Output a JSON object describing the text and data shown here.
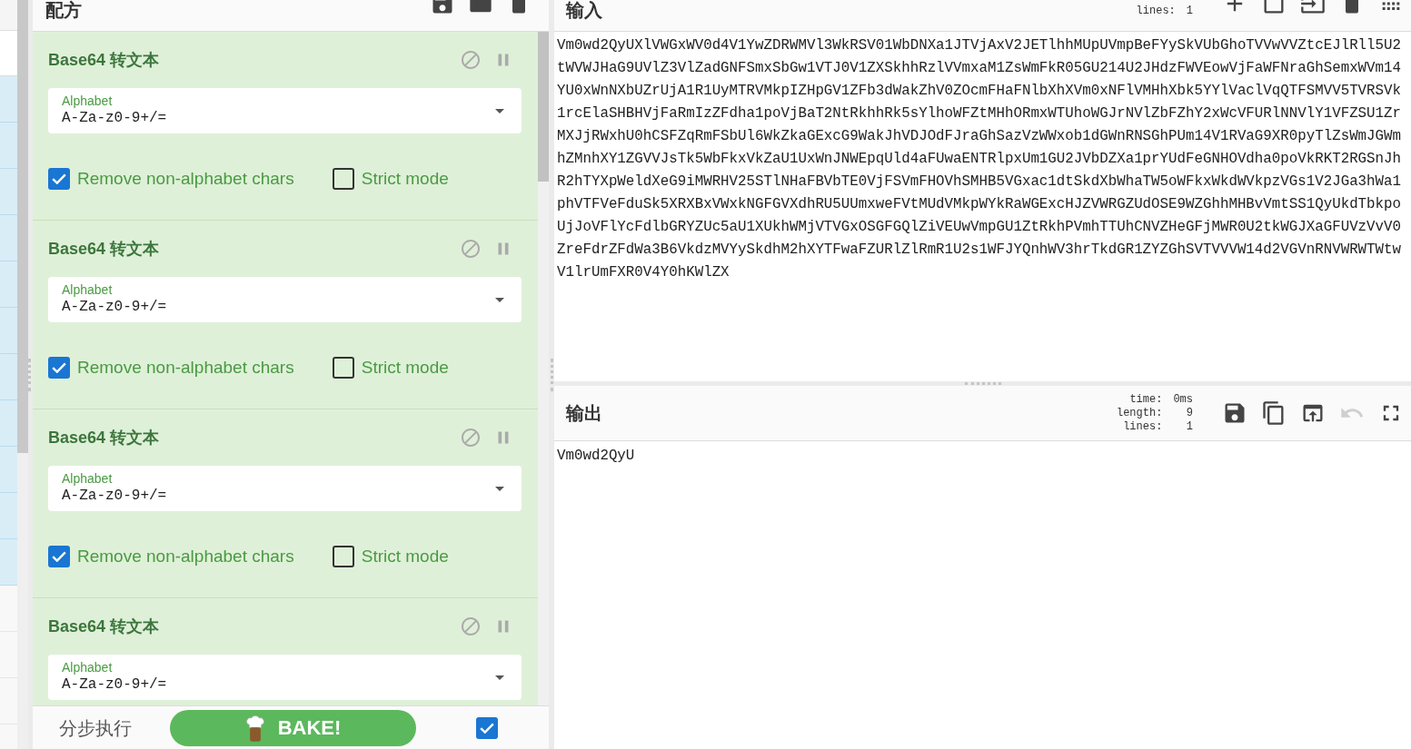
{
  "recipe": {
    "title": "配方",
    "operations": [
      {
        "title": "Base64 转文本",
        "args": [
          {
            "kind": "dropdown",
            "label": "Alphabet",
            "value": "A-Za-z0-9+/="
          },
          {
            "kind": "checkbox",
            "label": "Remove non-alphabet chars",
            "checked": true
          },
          {
            "kind": "checkbox",
            "label": "Strict mode",
            "checked": false
          }
        ]
      },
      {
        "title": "Base64 转文本",
        "args": [
          {
            "kind": "dropdown",
            "label": "Alphabet",
            "value": "A-Za-z0-9+/="
          },
          {
            "kind": "checkbox",
            "label": "Remove non-alphabet chars",
            "checked": true
          },
          {
            "kind": "checkbox",
            "label": "Strict mode",
            "checked": false
          }
        ]
      },
      {
        "title": "Base64 转文本",
        "args": [
          {
            "kind": "dropdown",
            "label": "Alphabet",
            "value": "A-Za-z0-9+/="
          },
          {
            "kind": "checkbox",
            "label": "Remove non-alphabet chars",
            "checked": true
          },
          {
            "kind": "checkbox",
            "label": "Strict mode",
            "checked": false
          }
        ]
      },
      {
        "title": "Base64 转文本",
        "args": [
          {
            "kind": "dropdown",
            "label": "Alphabet",
            "value": "A-Za-z0-9+/="
          }
        ]
      }
    ]
  },
  "controls": {
    "step": "分步执行",
    "bake": "BAKE!",
    "auto_bake": {
      "checked": true
    }
  },
  "input": {
    "title": "输入",
    "stats": [
      {
        "label": "lines:",
        "value": "1"
      }
    ],
    "lines": [
      "Vm0wd2QyUXlVWGxWV0d4V1YwZDRWMVl3WkRSV01WbDNXa1JTVjAxV2JETlhhMUpUVmpBeFYySkVUbGhoTVVwVVZtcEJlRll5U2",
      "tWVWJHaG9UVlZ3VlZadGNFSmxSbGw1VTJ0V1ZXSkhhRzlVVmxaM1ZsWmFkR05GU214U2JHdzFWVEowVjFaWFNraGhSemxWVm14",
      "YU0xWnNXbUZrUjA1R1UyMTRVMkpIZHpGV1ZFb3dWakZhV0ZOcmFHaFNlbXhXVm0xNFlVMHhXbk5YYlVaclVqQTFSMVV5TVRSVk",
      "1rcElaSHBHVjFaRmIzZFdha1poVjBaT2NtRkhhRk5sYlhoWFZtMHhORmxWTUhoWGJrNVlZbFZhY2xWcVFURlNNVlY1VFZSU1Zr",
      "MXJjRWxhU0hCSFZqRmFSbUl6WkZkaGExcG9WakJhVDJOdFJraGhSazVzWWxob1dGWnRNSGhPUm14V1RVaG9XR0pyTlZsWmJGWm",
      "hZMnhXY1ZGVVJsTk5WbFkxVkZaU1UxWnJNWEpqUld4aFUwaENTRlpxUm1GU2JVbDZXa1prYUdFeGNHOVdha0poVkRKT2RGSnJh",
      "R2hTYXpWeldXeG9iMWRHV25STlNHaFBVbTE0VjFSVmFHOVhSMHB5VGxac1dtSkdXbWhaTW5oWFkxWkdWVkpzVGs1V2JGa3hWa1",
      "phVTFVeFduSk5XRXBxVWxkNGFGVXdhRU5UUmxweFVtMUdVMkpWYkRaWGExcHJZVWRGZUdOSE9WZGhhMHBvVmtSS1QyUkdTbkpo",
      "UjJoVFlYcFdlbGRYZUc5aU1XUkhWMjVTVGxOSGFGQlZiVEUwVmpGU1ZtRkhPVmhTTUhCNVZHeGFjMWR0U2tkWGJXaGFUVzVvV0",
      "ZreFdrZFdWa3B6VkdzMVYySkdhM2hXYTFwaFZURlZlRmR1U2s1WFJYQnhWV3hrTkdGR1ZYZGhSVTVVVW14d2VGVnRNVWRWTWtw",
      "V1lrUmFXR0V4Y0hKWlZX"
    ]
  },
  "output": {
    "title": "输出",
    "stats": [
      {
        "label": "time:",
        "value": "0ms"
      },
      {
        "label": "length:",
        "value": "9"
      },
      {
        "label": "lines:",
        "value": "1"
      }
    ],
    "undo": {
      "disabled": true
    },
    "text": "Vm0wd2QyU"
  }
}
